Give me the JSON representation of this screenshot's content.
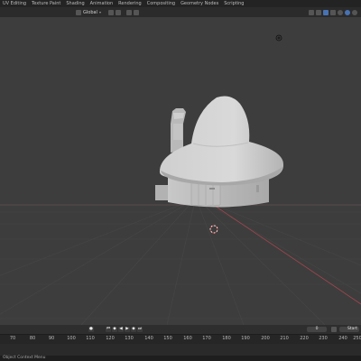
{
  "workspace_tabs": [
    "UV Editing",
    "Texture Paint",
    "Shading",
    "Animation",
    "Rendering",
    "Compositing",
    "Geometry Nodes",
    "Scripting"
  ],
  "header": {
    "orientation_label": "Global"
  },
  "timeline": {
    "ruler_ticks": [
      "70",
      "80",
      "90",
      "100",
      "110",
      "120",
      "130",
      "140",
      "150",
      "160",
      "170",
      "180",
      "190",
      "200",
      "210",
      "220",
      "230",
      "240",
      "250"
    ],
    "current_frame": "0",
    "start_label": "Start",
    "start_value": "1"
  },
  "status_bar": {
    "left_text": "Object Context Menu"
  },
  "scene": {
    "background_color": "#3d3d3d",
    "model_color": "#d2d2d2",
    "x_axis_color": "#a3454e"
  }
}
